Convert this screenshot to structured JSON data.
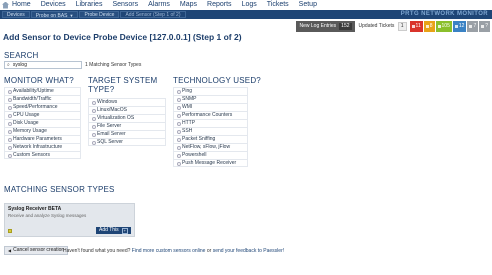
{
  "topnav": {
    "items": [
      "Home",
      "Devices",
      "Libraries",
      "Sensors",
      "Alarms",
      "Maps",
      "Reports",
      "Logs",
      "Tickets",
      "Setup"
    ]
  },
  "breadcrumb": {
    "items": [
      "Devices",
      "Probe on BAS",
      "Probe Device",
      "Add Sensor (Step 1 of 2)"
    ]
  },
  "brand": "PRTG NETWORK MONITOR",
  "status": {
    "new_log_label": "New Log Entries",
    "new_log_count": "152",
    "updated_label": "Updated Tickets",
    "updated_count": "1",
    "badges": [
      {
        "value": "11",
        "color": "#d9342b"
      },
      {
        "value": "8",
        "color": "#e8a217"
      },
      {
        "value": "105",
        "color": "#8abf2c"
      },
      {
        "value": "12",
        "color": "#3a82c4"
      },
      {
        "value": "7",
        "color": "#9aa0a6"
      },
      {
        "value": "?",
        "color": "#9aa0a6"
      }
    ]
  },
  "page_title": "Add Sensor to Device Probe Device [127.0.0.1] (Step 1 of 2)",
  "search": {
    "heading": "SEARCH",
    "value": "syslog",
    "match_text": "1 Matching Sensor Types"
  },
  "monitor_what": {
    "heading": "MONITOR WHAT?",
    "items": [
      "Availability/Uptime",
      "Bandwidth/Traffic",
      "Speed/Performance",
      "CPU Usage",
      "Disk Usage",
      "Memory Usage",
      "Hardware Parameters",
      "Network Infrastructure",
      "Custom Sensors"
    ]
  },
  "target_system": {
    "heading_line1": "TARGET SYSTEM",
    "heading_line2": "TYPE?",
    "items": [
      "Windows",
      "Linux/MacOS",
      "Virtualization OS",
      "File Server",
      "Email Server",
      "SQL Server"
    ]
  },
  "technology": {
    "heading": "TECHNOLOGY USED?",
    "items": [
      "Ping",
      "SNMP",
      "WMI",
      "Performance Counters",
      "HTTP",
      "SSH",
      "Packet Sniffing",
      "NetFlow, sFlow, jFlow",
      "Powershell",
      "Push Message Receiver"
    ]
  },
  "matching": {
    "heading": "MATCHING SENSOR TYPES",
    "card_title": "Syslog Receiver BETA",
    "card_desc": "Receive and analyze Syslog messages",
    "add_label": "Add This"
  },
  "footer": {
    "cancel_label": "Cancel sensor creation",
    "text_prefix": "Haven't found what you need?",
    "link1": "Find more custom sensors online",
    "text_mid": "or",
    "link2": "send your feedback to Paessler!"
  }
}
